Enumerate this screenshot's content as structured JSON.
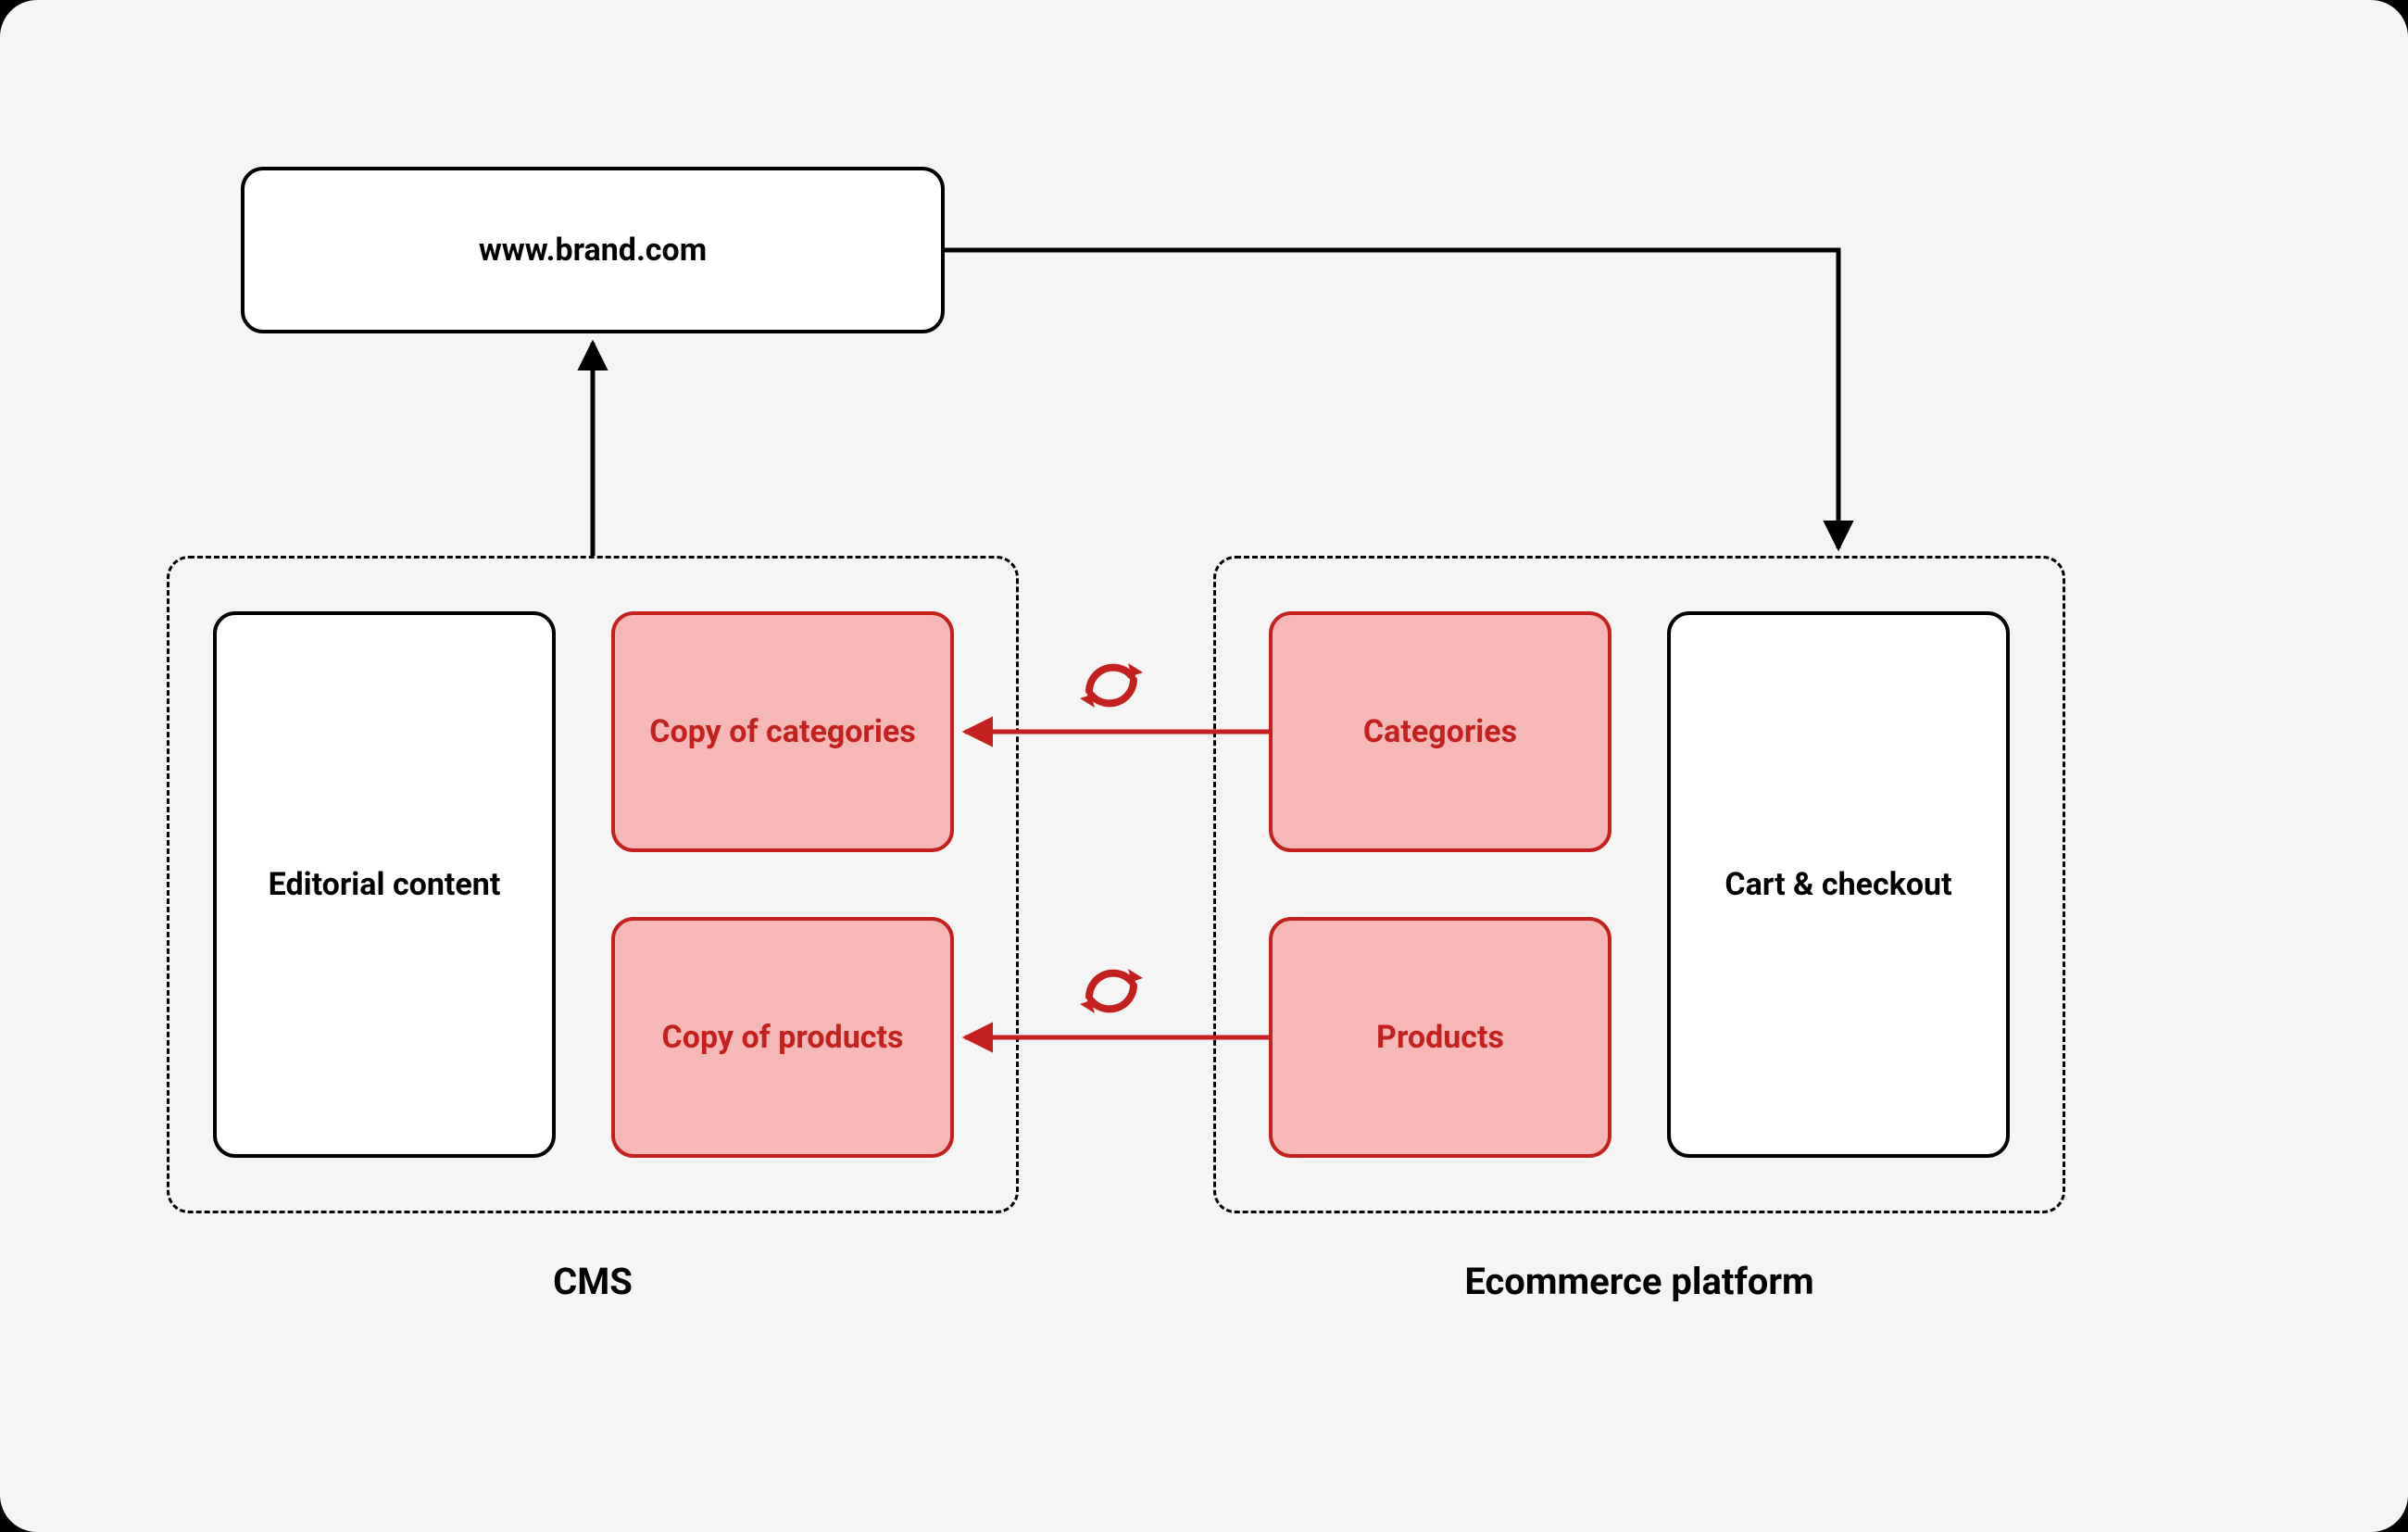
{
  "nodes": {
    "website": "www.brand.com",
    "editorial": "Editorial content",
    "copy_categories": "Copy of categories",
    "copy_products": "Copy of products",
    "categories": "Categories",
    "products": "Products",
    "cart": "Cart & checkout"
  },
  "groups": {
    "cms": "CMS",
    "ecommerce": "Ecommerce platform"
  },
  "colors": {
    "red": "#c4201d",
    "red_fill": "#f5b8b6",
    "black": "#000000",
    "canvas": "#f5f5f5"
  }
}
